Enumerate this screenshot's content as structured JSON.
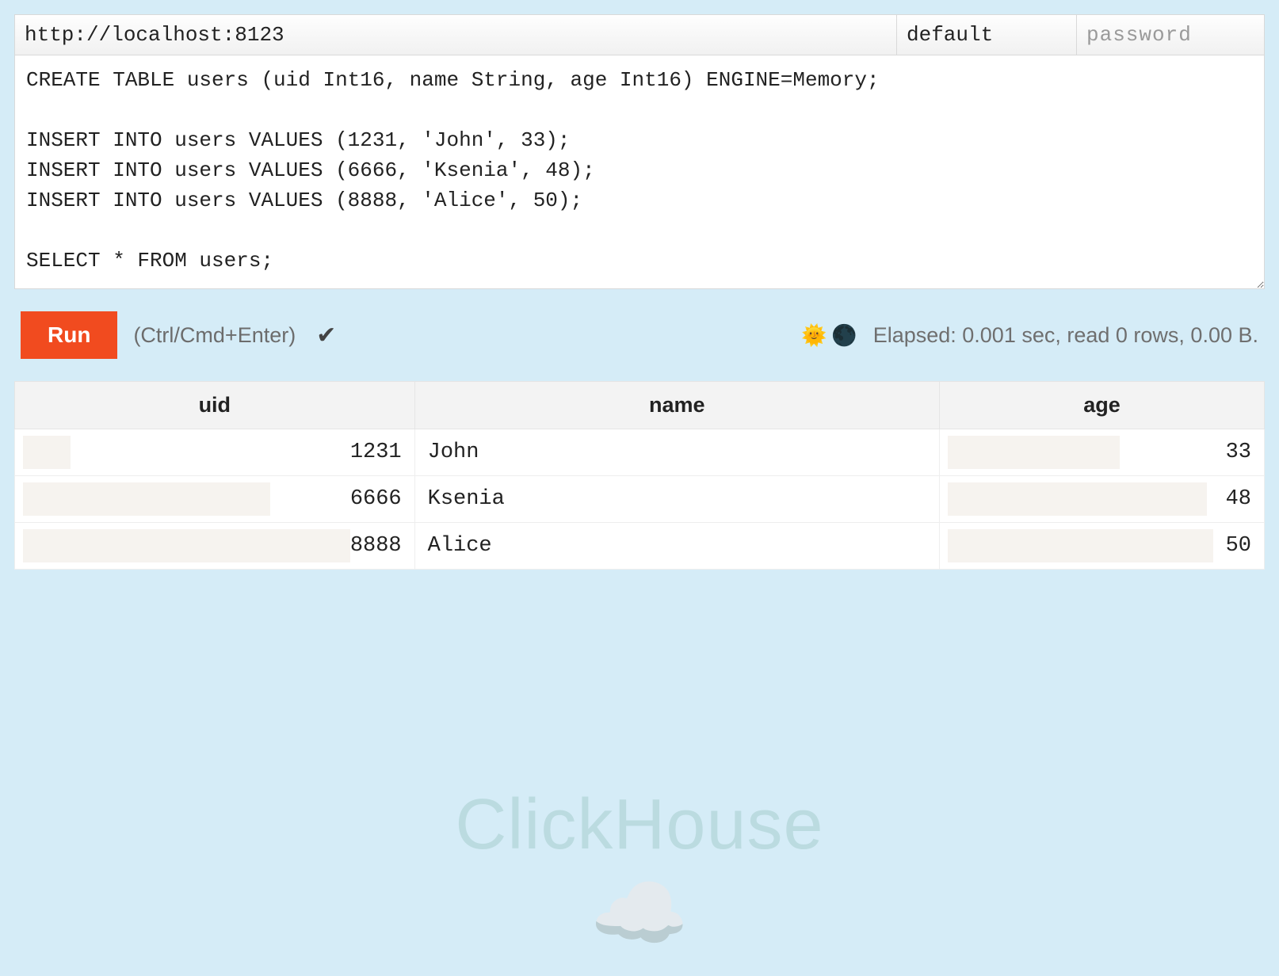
{
  "connection": {
    "url": "http://localhost:8123",
    "user": "default",
    "password_placeholder": "password"
  },
  "query": "CREATE TABLE users (uid Int16, name String, age Int16) ENGINE=Memory;\n\nINSERT INTO users VALUES (1231, 'John', 33);\nINSERT INTO users VALUES (6666, 'Ksenia', 48);\nINSERT INTO users VALUES (8888, 'Alice', 50);\n\nSELECT * FROM users;",
  "toolbar": {
    "run_label": "Run",
    "hint": "(Ctrl/Cmd+Enter)",
    "check": "✔",
    "sun": "🌞",
    "moon": "🌑"
  },
  "stats": "Elapsed: 0.001 sec, read 0 rows, 0.00 B.",
  "results": {
    "columns": [
      "uid",
      "name",
      "age"
    ],
    "column_types": [
      "num",
      "str",
      "num"
    ],
    "rows": [
      {
        "uid": "1231",
        "name": "John",
        "age": "33",
        "uid_bar": 12,
        "age_bar": 53
      },
      {
        "uid": "6666",
        "name": "Ksenia",
        "age": "48",
        "uid_bar": 62,
        "age_bar": 80
      },
      {
        "uid": "8888",
        "name": "Alice",
        "age": "50",
        "uid_bar": 82,
        "age_bar": 82
      }
    ]
  },
  "watermark": "ClickHouse",
  "cloud": "☁️"
}
